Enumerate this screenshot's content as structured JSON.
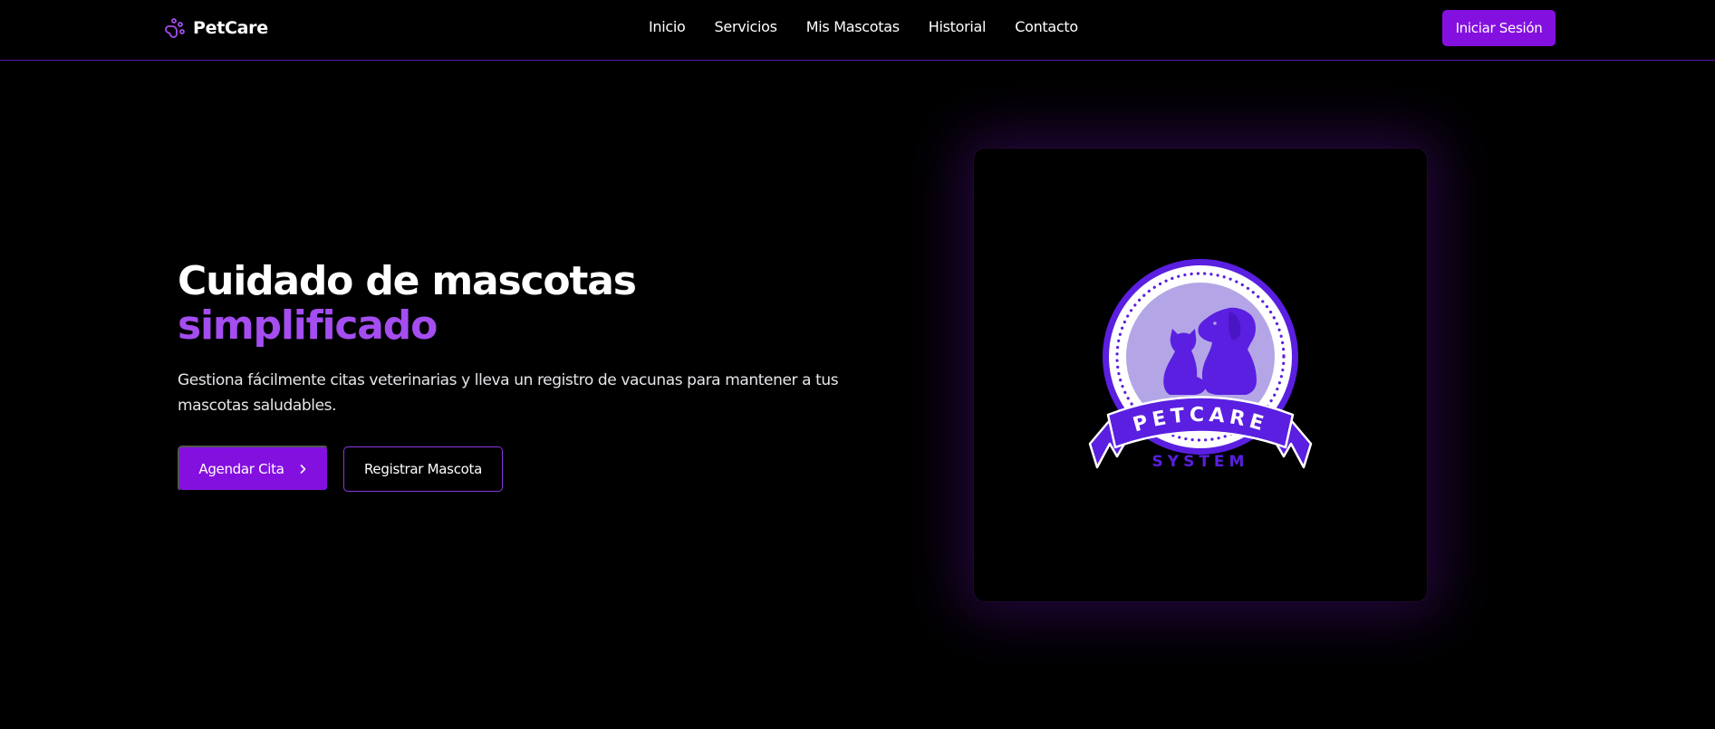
{
  "navbar": {
    "brand": "PetCare",
    "brand_icon": "paw-icon",
    "links": [
      "Inicio",
      "Servicios",
      "Mis Mascotas",
      "Historial",
      "Contacto"
    ],
    "login_label": "Iniciar Sesión"
  },
  "hero": {
    "title_line1": "Cuidado de mascotas",
    "title_line2": "simplificado",
    "description": "Gestiona fácilmente citas veterinarias y lleva un registro de vacunas para mantener a tus mascotas saludables.",
    "primary_button": "Agendar Cita",
    "primary_icon": "chevron-right-icon",
    "secondary_button": "Registrar Mascota"
  },
  "logo": {
    "text_top": "PETCARE",
    "text_bottom": "SYSTEM",
    "icon": "dog-and-cat-badge-icon"
  },
  "colors": {
    "accent": "#8410e0",
    "accent_light": "#a44df0",
    "badge_purple": "#5a1fe0",
    "badge_inner": "#b4a6e6",
    "background": "#000000"
  }
}
